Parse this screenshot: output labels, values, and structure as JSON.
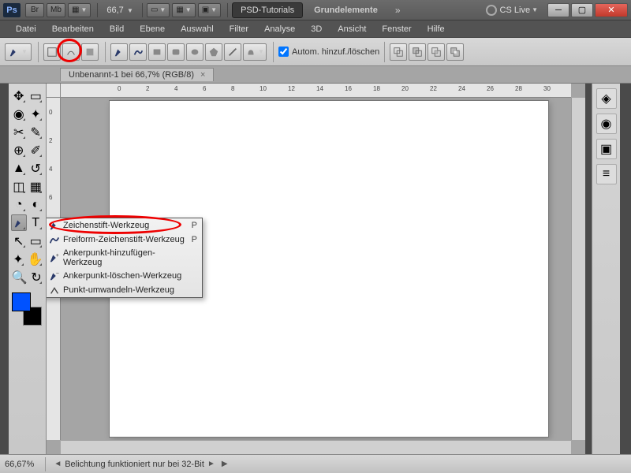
{
  "titlebar": {
    "logo": "Ps",
    "br": "Br",
    "mb": "Mb",
    "zoom": "66,7",
    "tab1": "PSD-Tutorials",
    "tab2": "Grundelemente",
    "cslive": "CS Live"
  },
  "menu": [
    "Datei",
    "Bearbeiten",
    "Bild",
    "Ebene",
    "Auswahl",
    "Filter",
    "Analyse",
    "3D",
    "Ansicht",
    "Fenster",
    "Hilfe"
  ],
  "options": {
    "autoAddDelete": "Autom. hinzuf./löschen"
  },
  "doctab": {
    "label": "Unbenannt-1 bei 66,7% (RGB/8)"
  },
  "ruler_h": [
    "0",
    "2",
    "4",
    "6",
    "8",
    "10",
    "12",
    "14",
    "16",
    "18",
    "20",
    "22",
    "24",
    "26",
    "28",
    "30"
  ],
  "ruler_v": [
    "0",
    "2",
    "4",
    "6"
  ],
  "flyout": {
    "items": [
      {
        "label": "Zeichenstift-Werkzeug",
        "short": "P",
        "active": true
      },
      {
        "label": "Freiform-Zeichenstift-Werkzeug",
        "short": "P",
        "active": false
      },
      {
        "label": "Ankerpunkt-hinzufügen-Werkzeug",
        "short": "",
        "active": false
      },
      {
        "label": "Ankerpunkt-löschen-Werkzeug",
        "short": "",
        "active": false
      },
      {
        "label": "Punkt-umwandeln-Werkzeug",
        "short": "",
        "active": false
      }
    ]
  },
  "status": {
    "zoom": "66,67%",
    "msg": "Belichtung funktioniert nur bei 32-Bit"
  },
  "colors": {
    "fg": "#0052ff",
    "bg": "#000000"
  }
}
